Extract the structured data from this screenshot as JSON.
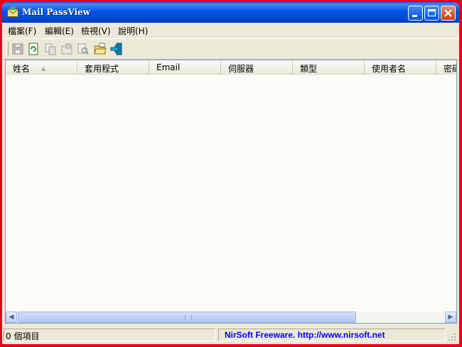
{
  "window": {
    "title": "Mail PassView"
  },
  "menu": {
    "items": [
      "檔案(F)",
      "編輯(E)",
      "檢視(V)",
      "說明(H)"
    ]
  },
  "toolbar": {
    "icons": [
      "save-icon",
      "refresh-icon",
      "copy-icon",
      "properties-icon",
      "find-icon",
      "open-folder-icon",
      "exit-icon"
    ]
  },
  "list": {
    "columns": [
      "姓名",
      "套用程式",
      "Email",
      "伺服器",
      "類型",
      "使用者名",
      "密碼"
    ]
  },
  "status": {
    "count": "0 個項目",
    "credit": "NirSoft Freeware.  http://www.nirsoft.net"
  },
  "colors": {
    "titlebar": "#0054e3",
    "link": "#0000ff",
    "frame": "#e6001e"
  }
}
